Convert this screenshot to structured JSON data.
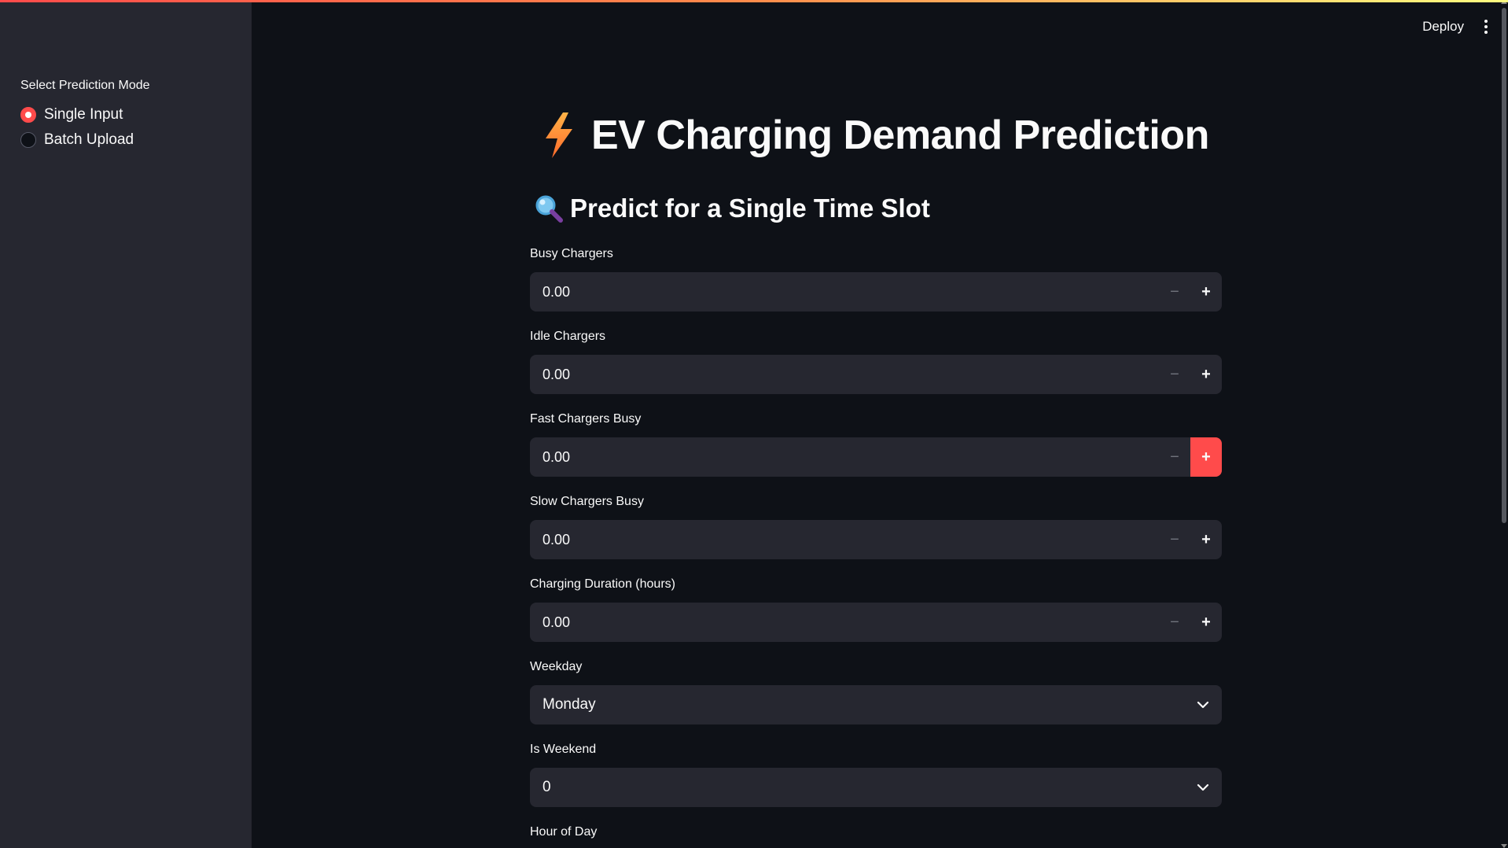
{
  "sidebar": {
    "mode_label": "Select Prediction Mode",
    "options": [
      {
        "label": "Single Input",
        "selected": true
      },
      {
        "label": "Batch Upload",
        "selected": false
      }
    ]
  },
  "header": {
    "deploy_label": "Deploy",
    "menu_icon": "kebab-menu-icon"
  },
  "main": {
    "title": "EV Charging Demand Prediction",
    "title_icon": "lightning-bolt-icon",
    "subtitle": "Predict for a Single Time Slot",
    "subtitle_icon": "magnifying-glass-icon",
    "fields": [
      {
        "label": "Busy Chargers",
        "type": "number",
        "value": "0.00"
      },
      {
        "label": "Idle Chargers",
        "type": "number",
        "value": "0.00"
      },
      {
        "label": "Fast Chargers Busy",
        "type": "number",
        "value": "0.00"
      },
      {
        "label": "Slow Chargers Busy",
        "type": "number",
        "value": "0.00"
      },
      {
        "label": "Charging Duration (hours)",
        "type": "number",
        "value": "0.00"
      },
      {
        "label": "Weekday",
        "type": "select",
        "value": "Monday"
      },
      {
        "label": "Is Weekend",
        "type": "select",
        "value": "0"
      },
      {
        "label": "Hour of Day"
      }
    ]
  },
  "colors": {
    "accent": "#ff4b4b",
    "background": "#0e1117",
    "sidebar_bg": "#262730",
    "input_bg": "#262730",
    "text": "#fafafa"
  }
}
